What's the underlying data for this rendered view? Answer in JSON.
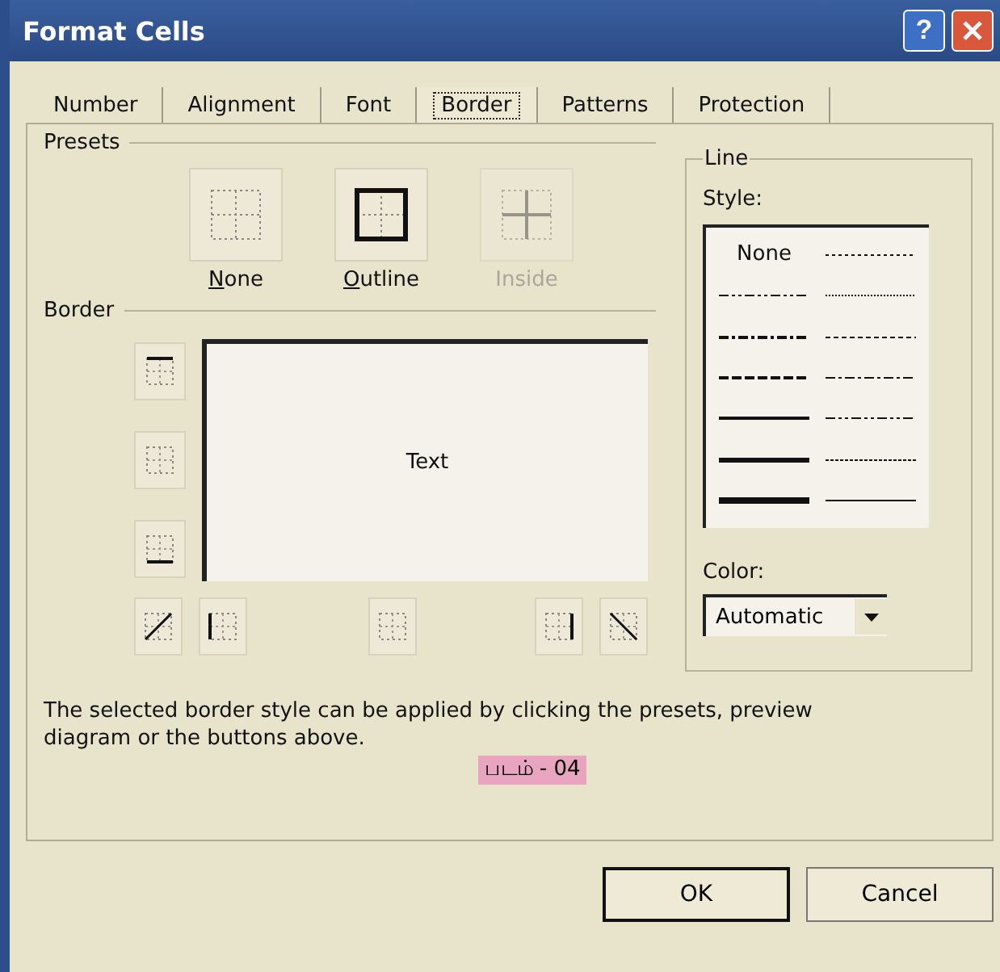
{
  "window": {
    "title": "Format Cells",
    "help": "?"
  },
  "tabs": [
    {
      "label": "Number",
      "selected": false
    },
    {
      "label": "Alignment",
      "selected": false
    },
    {
      "label": "Font",
      "selected": false
    },
    {
      "label": "Border",
      "selected": true
    },
    {
      "label": "Patterns",
      "selected": false
    },
    {
      "label": "Protection",
      "selected": false
    }
  ],
  "presets": {
    "title": "Presets",
    "items": [
      {
        "label": "None",
        "kind": "none",
        "access_key_first": true,
        "disabled": false
      },
      {
        "label": "Outline",
        "kind": "outline",
        "access_key_first": true,
        "disabled": false
      },
      {
        "label": "Inside",
        "kind": "inside",
        "access_key_first": false,
        "disabled": true
      }
    ]
  },
  "border": {
    "title": "Border",
    "preview_text": "Text"
  },
  "line": {
    "title": "Line",
    "style_label": "Style:",
    "style_none": "None",
    "color_label": "Color:",
    "color_value": "Automatic"
  },
  "description": "The selected border style can be applied by clicking the presets, preview diagram or the buttons above.",
  "caption": "படம் - 04",
  "buttons": [
    {
      "label": "OK",
      "default": true
    },
    {
      "label": "Cancel",
      "default": false
    }
  ]
}
